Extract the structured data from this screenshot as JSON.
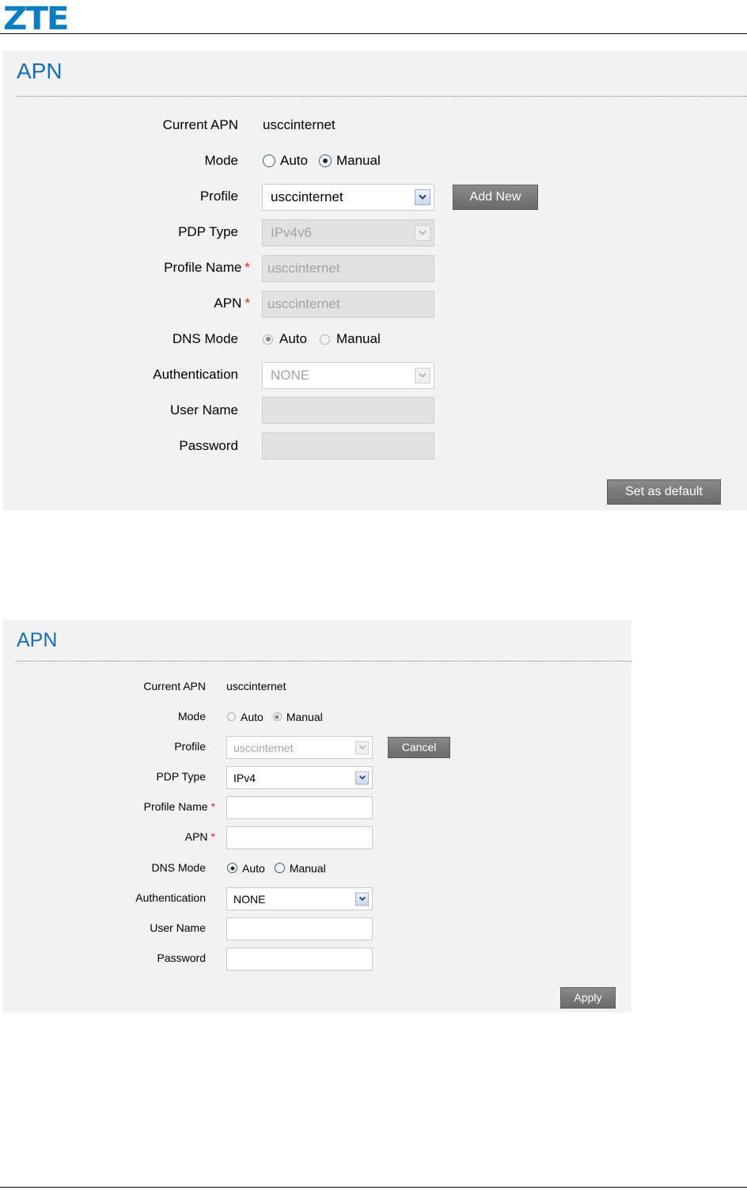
{
  "brand": {
    "logo_text": "ZTE",
    "accent": "#0b7dc2"
  },
  "panel1": {
    "title": "APN",
    "current_apn": {
      "label": "Current APN",
      "value": "usccinternet"
    },
    "mode": {
      "label": "Mode",
      "options": [
        "Auto",
        "Manual"
      ],
      "selected": "Manual"
    },
    "profile": {
      "label": "Profile",
      "value": "usccinternet",
      "add_new_label": "Add New"
    },
    "pdp_type": {
      "label": "PDP Type",
      "value": "IPv4v6"
    },
    "profile_name": {
      "label": "Profile Name",
      "required_mark": "*",
      "value": "usccinternet"
    },
    "apn": {
      "label": "APN",
      "required_mark": "*",
      "value": "usccinternet"
    },
    "dns_mode": {
      "label": "DNS Mode",
      "options": [
        "Auto",
        "Manual"
      ],
      "selected": "Auto"
    },
    "authentication": {
      "label": "Authentication",
      "value": "NONE"
    },
    "user_name": {
      "label": "User Name",
      "value": ""
    },
    "password": {
      "label": "Password",
      "value": ""
    },
    "set_default_label": "Set as default"
  },
  "panel2": {
    "title": "APN",
    "current_apn": {
      "label": "Current APN",
      "value": "usccinternet"
    },
    "mode": {
      "label": "Mode",
      "options": [
        "Auto",
        "Manual"
      ],
      "selected": "Manual"
    },
    "profile": {
      "label": "Profile",
      "value": "usccinternet",
      "cancel_label": "Cancel"
    },
    "pdp_type": {
      "label": "PDP Type",
      "value": "IPv4"
    },
    "profile_name": {
      "label": "Profile Name",
      "required_mark": "*",
      "value": ""
    },
    "apn": {
      "label": "APN",
      "required_mark": "*",
      "value": ""
    },
    "dns_mode": {
      "label": "DNS Mode",
      "options": [
        "Auto",
        "Manual"
      ],
      "selected": "Auto"
    },
    "authentication": {
      "label": "Authentication",
      "value": "NONE"
    },
    "user_name": {
      "label": "User Name",
      "value": ""
    },
    "password": {
      "label": "Password",
      "value": ""
    },
    "apply_label": "Apply"
  }
}
